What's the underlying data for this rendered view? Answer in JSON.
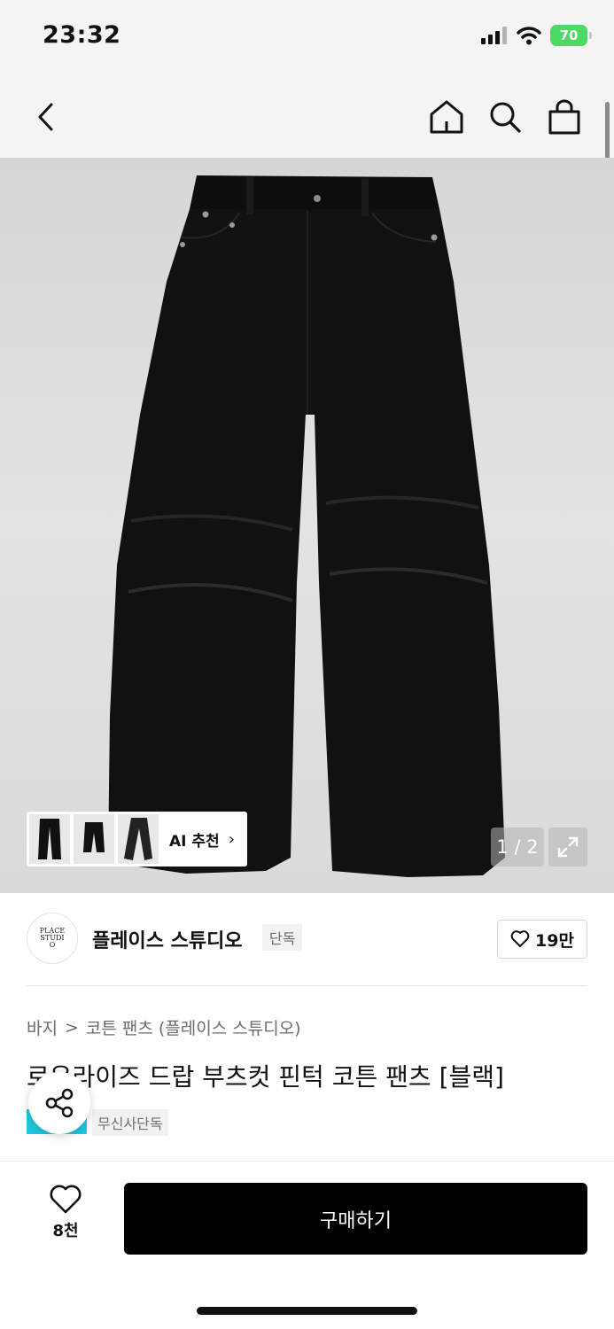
{
  "status_bar": {
    "time": "23:32",
    "battery": "70"
  },
  "nav": {
    "back_icon": "chevron-left-icon",
    "home_icon": "home-icon",
    "search_icon": "search-icon",
    "cart_icon": "shopping-bag-icon"
  },
  "gallery": {
    "ai_reco_label": "AI 추천",
    "page_indicator": "1 / 2",
    "expand_icon": "expand-icon"
  },
  "brand": {
    "logo_text": "PLACE STUDIO",
    "name": "플레이스 스튜디오",
    "badge": "단독",
    "likes": "19만"
  },
  "breadcrumb": {
    "category": "바지",
    "separator": ">",
    "subcategory": "코튼 팬츠 (플레이스 스튜디오)"
  },
  "product": {
    "title": "로우라이즈 드랍 부츠컷 핀턱 코튼 팬츠 [블랙]",
    "exclusive_tag": "무신사단독"
  },
  "bottom_bar": {
    "wish_count": "8천",
    "buy_label": "구매하기"
  },
  "colors": {
    "accent_cyan": "#21c6e0",
    "battery_green": "#4cd964",
    "buy_button": "#000000"
  }
}
